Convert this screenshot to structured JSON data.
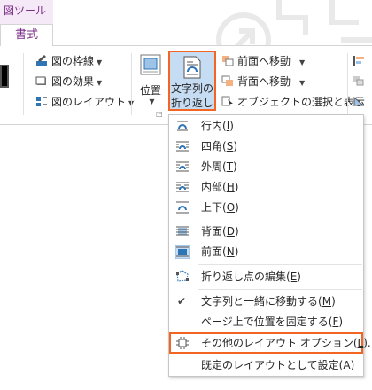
{
  "context_tab_group": "図ツール",
  "active_tab": "書式",
  "ribbon": {
    "border_label": "図の枠線",
    "effects_label": "図の効果",
    "layout_label": "図のレイアウト",
    "position_label": "位置",
    "wrap_line1": "文字列の",
    "wrap_line2": "折り返し",
    "bring_forward": "前面へ移動",
    "send_backward": "背面へ移動",
    "selection_pane": "オブジェクトの選択と表示"
  },
  "wrap_menu": {
    "items": [
      {
        "text": "行内",
        "key": "I"
      },
      {
        "text": "四角",
        "key": "S"
      },
      {
        "text": "外周",
        "key": "T"
      },
      {
        "text": "内部",
        "key": "H"
      },
      {
        "text": "上下",
        "key": "O"
      },
      {
        "text": "背面",
        "key": "D"
      },
      {
        "text": "前面",
        "key": "N"
      },
      {
        "text": "折り返し点の編集",
        "key": "E"
      },
      {
        "text": "文字列と一緒に移動する",
        "key": "M"
      },
      {
        "text": "ページ上で位置を固定する",
        "key": "F"
      },
      {
        "text": "その他のレイアウト オプション",
        "key": "L",
        "suffix": "..."
      },
      {
        "text": "既定のレイアウトとして設定",
        "key": "A"
      }
    ]
  },
  "colors": {
    "accent_highlight": "#f26522",
    "context_tab": "#7a2f87",
    "selected_bg": "#c5dcf3"
  }
}
